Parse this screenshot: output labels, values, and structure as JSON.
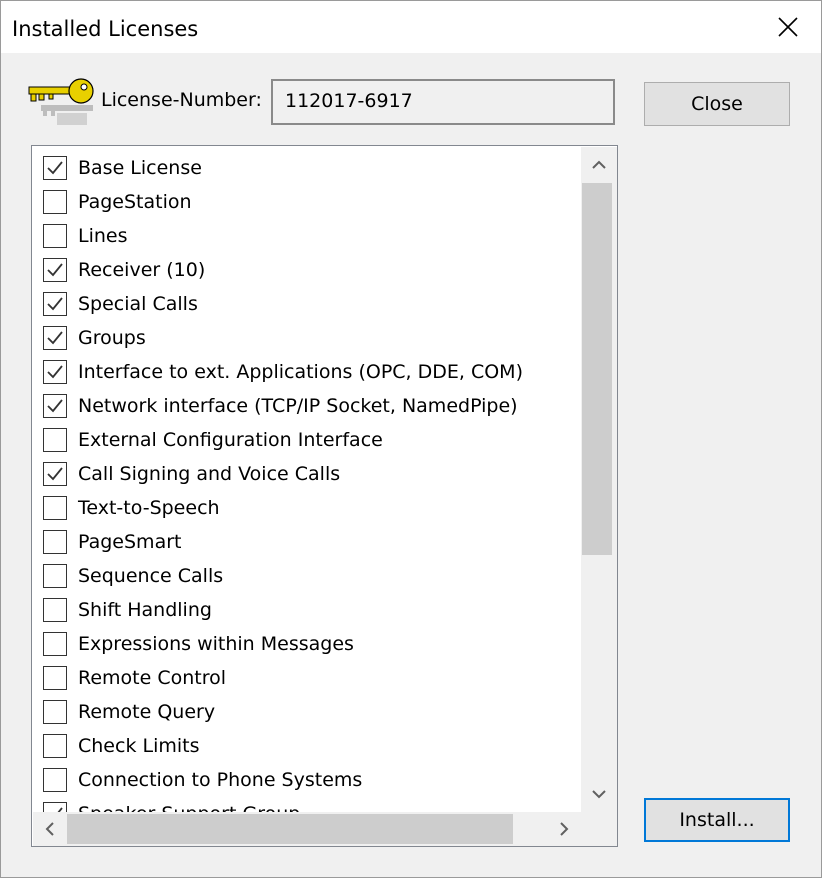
{
  "window": {
    "title": "Installed Licenses",
    "close_icon": "close-icon"
  },
  "license": {
    "label": "License-Number:",
    "value": "112017-6917",
    "icon": "key-icon"
  },
  "buttons": {
    "close_label": "Close",
    "install_label": "Install..."
  },
  "licenses": [
    {
      "label": "Base License",
      "checked": true
    },
    {
      "label": "PageStation",
      "checked": false
    },
    {
      "label": "Lines",
      "checked": false
    },
    {
      "label": "Receiver (10)",
      "checked": true
    },
    {
      "label": "Special Calls",
      "checked": true
    },
    {
      "label": "Groups",
      "checked": true
    },
    {
      "label": "Interface to ext. Applications (OPC, DDE, COM)",
      "checked": true
    },
    {
      "label": "Network interface (TCP/IP Socket, NamedPipe)",
      "checked": true
    },
    {
      "label": "External Configuration Interface",
      "checked": false
    },
    {
      "label": "Call Signing and Voice Calls",
      "checked": true
    },
    {
      "label": "Text-to-Speech",
      "checked": false
    },
    {
      "label": "PageSmart",
      "checked": false
    },
    {
      "label": "Sequence Calls",
      "checked": false
    },
    {
      "label": "Shift Handling",
      "checked": false
    },
    {
      "label": "Expressions within Messages",
      "checked": false
    },
    {
      "label": "Remote Control",
      "checked": false
    },
    {
      "label": "Remote Query",
      "checked": false
    },
    {
      "label": "Check Limits",
      "checked": false
    },
    {
      "label": "Connection to Phone Systems",
      "checked": false
    },
    {
      "label": "Speaker Support Group",
      "checked": true
    }
  ],
  "colors": {
    "dialog_bg": "#f0f0f0",
    "accent": "#0078d7",
    "key": "#e8d000"
  }
}
